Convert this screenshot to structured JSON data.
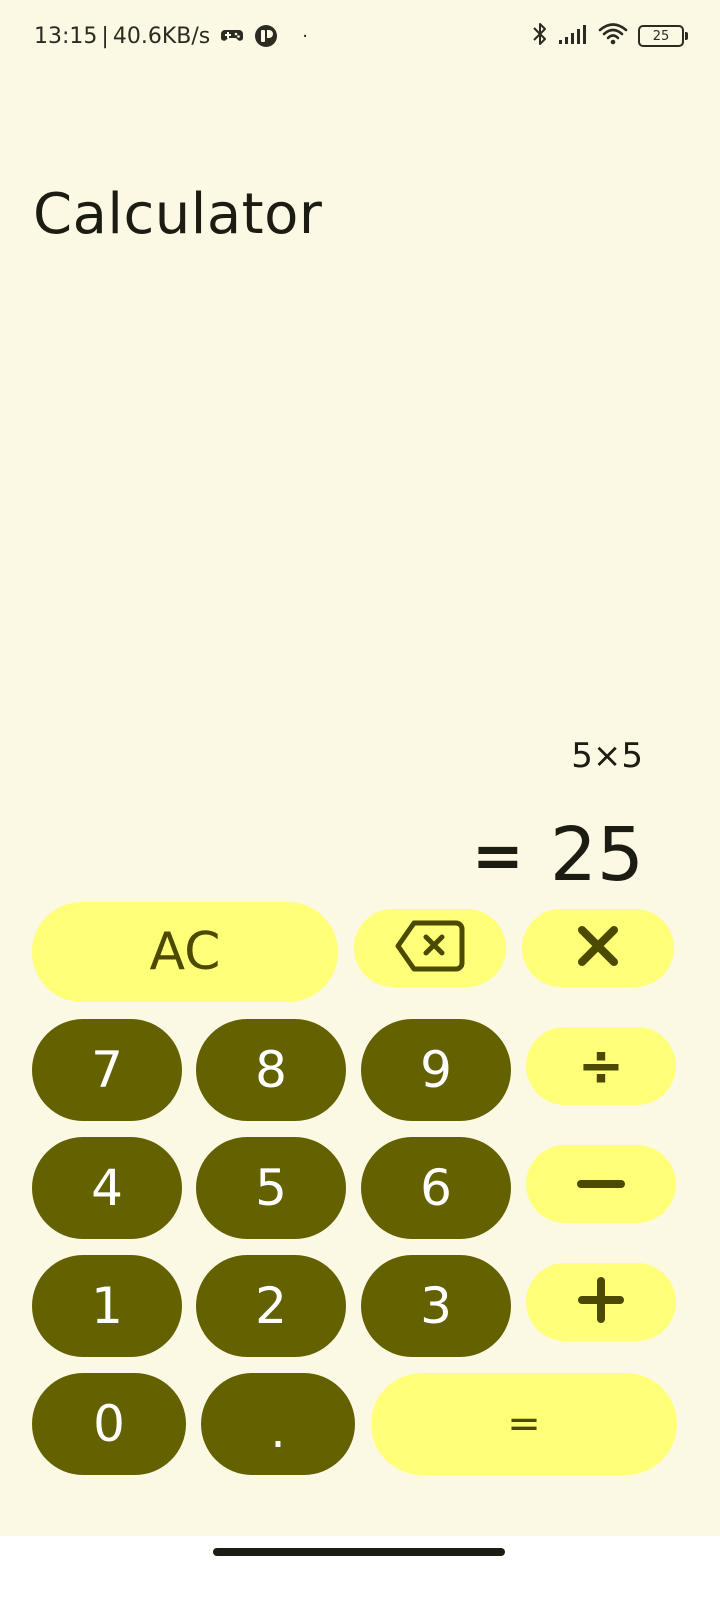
{
  "status_bar": {
    "time": "13:15",
    "separator": "|",
    "network_speed": "40.6KB/s",
    "battery_level": "25",
    "dot": "·",
    "icons": [
      "gamepad-icon",
      "app-icon",
      "bluetooth-icon",
      "signal-icon",
      "wifi-icon",
      "battery-icon"
    ]
  },
  "app": {
    "title": "Calculator"
  },
  "display": {
    "expression": "5×5",
    "result_prefix": "=",
    "result": "25"
  },
  "keys": {
    "clear": "AC",
    "backspace_icon": "backspace-icon",
    "multiply_icon": "multiply-icon",
    "divide": "÷",
    "subtract_icon": "minus-icon",
    "add_icon": "plus-icon",
    "equals": "=",
    "decimal": ".",
    "d7": "7",
    "d8": "8",
    "d9": "9",
    "d4": "4",
    "d5": "5",
    "d6": "6",
    "d1": "1",
    "d2": "2",
    "d3": "3",
    "d0": "0"
  },
  "colors": {
    "background": "#fbf9e3",
    "digit_key": "#636100",
    "operator_key": "#ffff78",
    "operator_text": "#4c4a00"
  }
}
